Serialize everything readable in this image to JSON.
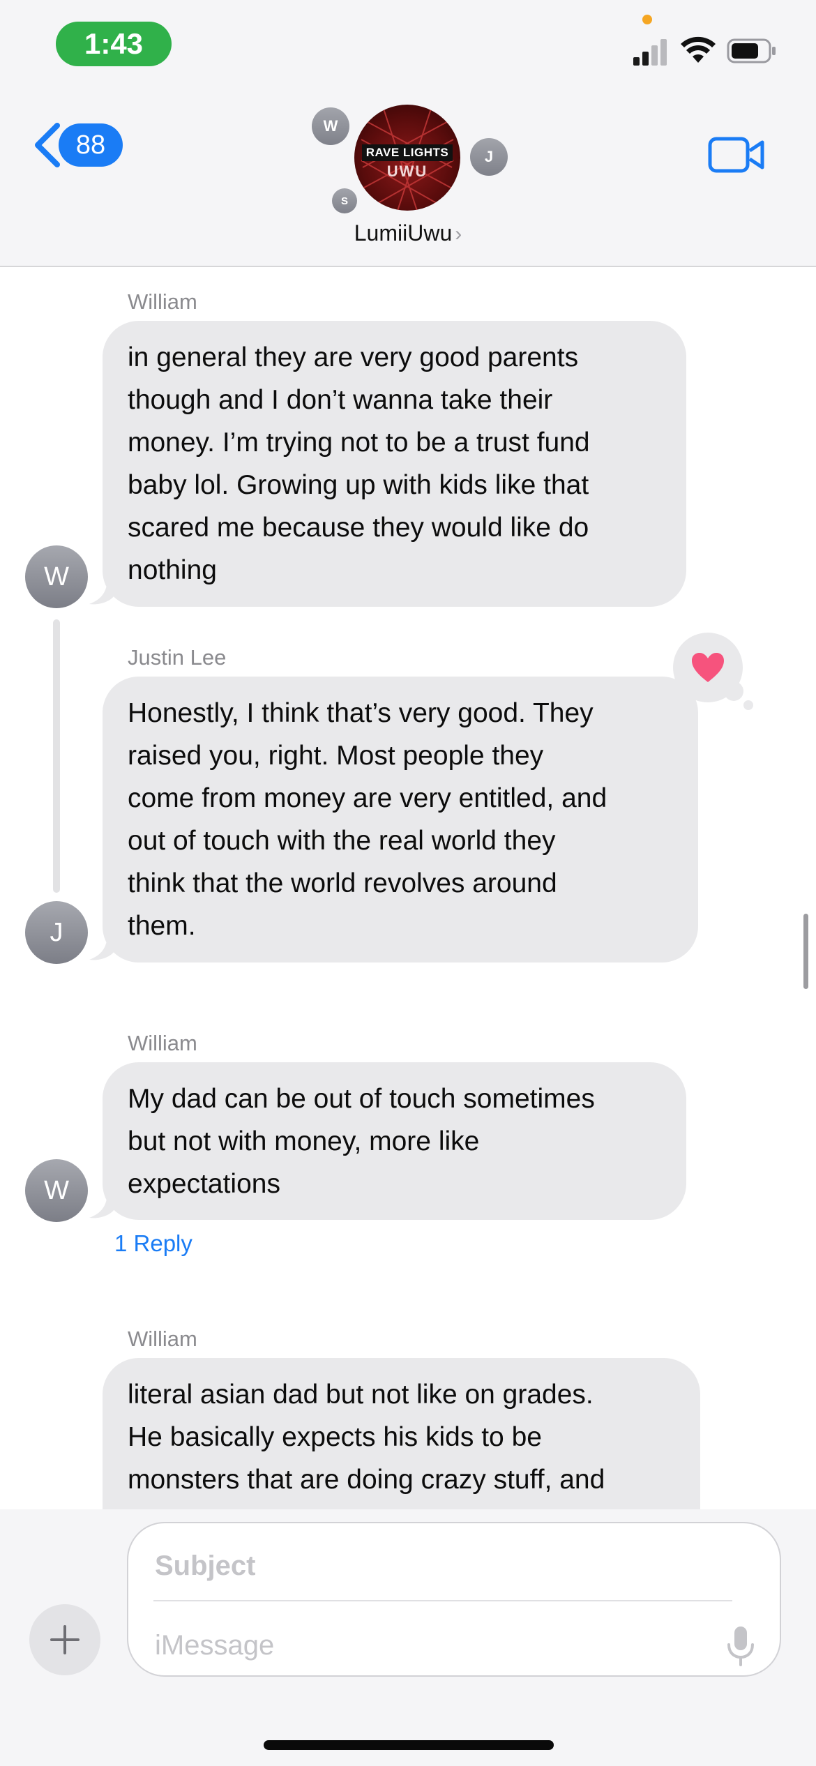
{
  "status_bar": {
    "time": "1:43",
    "time_pill_color": "#30b14a"
  },
  "nav": {
    "back_count": "88",
    "group_name": "LumiiUwu",
    "group_avatar_line1": "RAVE LIGHTS",
    "group_avatar_line2": "UWU",
    "members": [
      "W",
      "J",
      "S"
    ],
    "accent_color": "#1a7cf5"
  },
  "messages": [
    {
      "sender": "William",
      "avatar": "W",
      "text": "in general they are very good parents\nthough and I don’t wanna take their\nmoney. I’m trying not to be a trust fund\nbaby lol. Growing up with kids like that\nscared me because they would like do\nnothing"
    },
    {
      "sender": "Justin Lee",
      "avatar": "J",
      "reaction": "heart",
      "text": "Honestly, I think that’s very good. They\nraised you, right. Most people they\ncome from money are very entitled, and\nout of touch with the real world they\nthink that the world revolves around\nthem."
    },
    {
      "sender": "William",
      "avatar": "W",
      "text": "My dad can be out of touch sometimes\nbut not with money, more like\nexpectations",
      "replies": "1 Reply"
    },
    {
      "sender": "William",
      "text": "literal asian dad but not like on grades.\nHe basically expects his kids to be\nmonsters that are doing crazy stuff, and"
    }
  ],
  "compose": {
    "subject_placeholder": "Subject",
    "message_placeholder": "iMessage"
  },
  "icons": [
    "back-chevron-icon",
    "video-camera-icon",
    "heart-icon",
    "plus-icon",
    "microphone-icon",
    "wifi-icon",
    "signal-icon",
    "battery-icon"
  ]
}
